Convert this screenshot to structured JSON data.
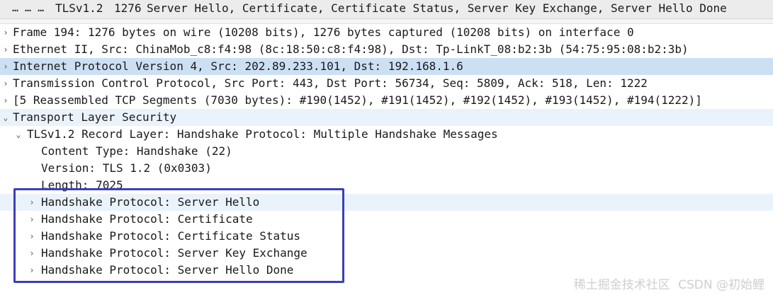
{
  "packet_list": {
    "selected_row": {
      "dots": "… … …",
      "protocol": "TLSv1.2",
      "length": "1276",
      "info": "Server Hello, Certificate, Certificate Status, Server Key Exchange, Server Hello Done"
    }
  },
  "tree": [
    {
      "level": 0,
      "arrow": "›",
      "label": "Frame 194: 1276 bytes on wire (10208 bits), 1276 bytes captured (10208 bits) on interface 0"
    },
    {
      "level": 0,
      "arrow": "›",
      "label": "Ethernet II, Src: ChinaMob_c8:f4:98 (8c:18:50:c8:f4:98), Dst: Tp-LinkT_08:b2:3b (54:75:95:08:b2:3b)"
    },
    {
      "level": 0,
      "arrow": "›",
      "label": "Internet Protocol Version 4, Src: 202.89.233.101, Dst: 192.168.1.6",
      "selected": true
    },
    {
      "level": 0,
      "arrow": "›",
      "label": "Transmission Control Protocol, Src Port: 443, Dst Port: 56734, Seq: 5809, Ack: 518, Len: 1222"
    },
    {
      "level": 0,
      "arrow": "›",
      "label": "[5 Reassembled TCP Segments (7030 bytes): #190(1452), #191(1452), #192(1452), #193(1452), #194(1222)]"
    },
    {
      "level": 0,
      "arrow": "⌄",
      "label": "Transport Layer Security",
      "hover": true
    },
    {
      "level": 1,
      "arrow": "⌄",
      "label": "TLSv1.2 Record Layer: Handshake Protocol: Multiple Handshake Messages"
    },
    {
      "level": 2,
      "arrow": "",
      "label": "Content Type: Handshake (22)"
    },
    {
      "level": 2,
      "arrow": "",
      "label": "Version: TLS 1.2 (0x0303)"
    },
    {
      "level": 2,
      "arrow": "",
      "label": "Length: 7025"
    },
    {
      "level": 2,
      "arrow": "›",
      "label": "Handshake Protocol: Server Hello",
      "hover": true
    },
    {
      "level": 2,
      "arrow": "›",
      "label": "Handshake Protocol: Certificate"
    },
    {
      "level": 2,
      "arrow": "›",
      "label": "Handshake Protocol: Certificate Status"
    },
    {
      "level": 2,
      "arrow": "›",
      "label": "Handshake Protocol: Server Key Exchange"
    },
    {
      "level": 2,
      "arrow": "›",
      "label": "Handshake Protocol: Server Hello Done"
    }
  ],
  "watermark": {
    "line1": "稀土掘金技术社区",
    "line2": "CSDN @初始鲤"
  },
  "colors": {
    "selected_bg": "#cce0f4",
    "hover_bg": "#eaf3fb",
    "box_border": "#3c3fb8",
    "packet_row_bg": "#ececec"
  }
}
